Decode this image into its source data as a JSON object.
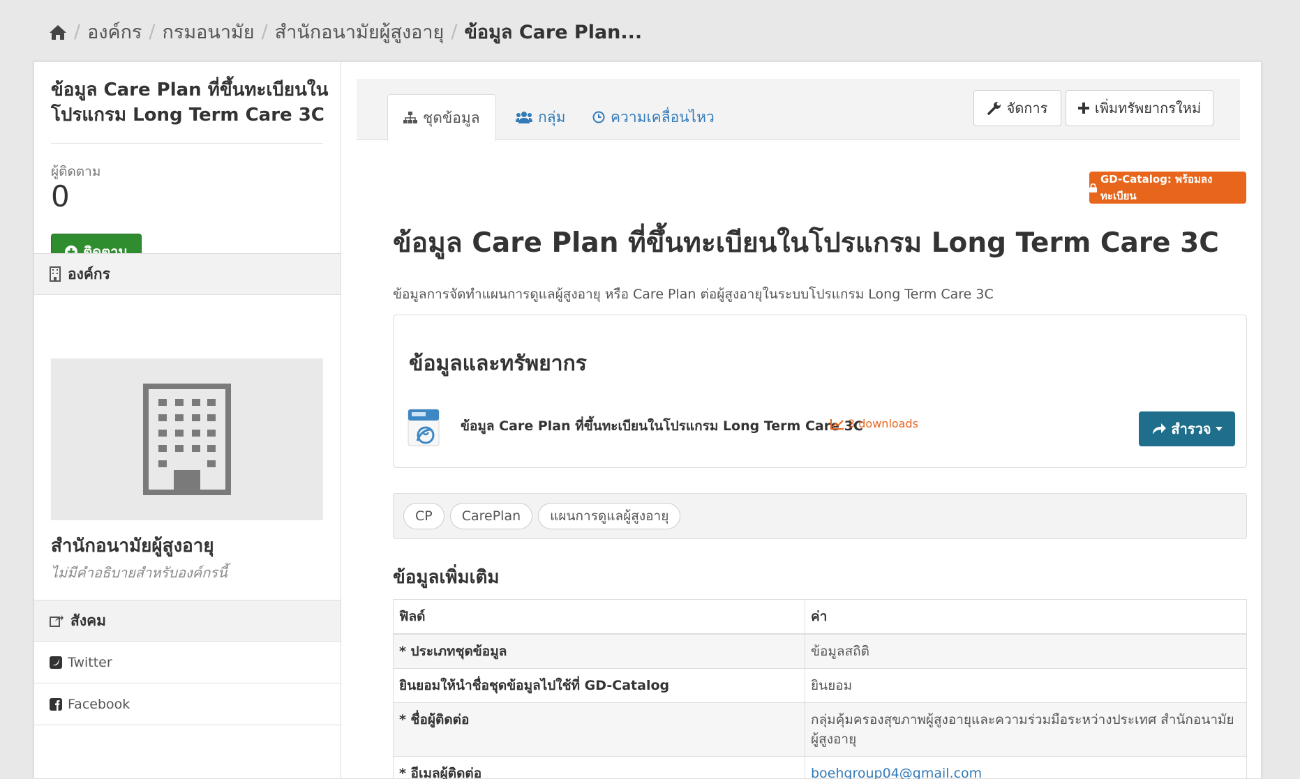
{
  "breadcrumb": {
    "home_icon": "home-icon",
    "items": [
      "องค์กร",
      "กรมอนามัย",
      "สำนักอนามัยผู้สูงอายุ",
      "ข้อมูล Care Plan..."
    ]
  },
  "sidebar": {
    "title": "ข้อมูล Care Plan ที่ขึ้นทะเบียนใน โปรแกรม Long Term Care 3C",
    "followers_label": "ผู้ติดตาม",
    "followers_count": "0",
    "follow_button": "ติดตาม",
    "org_heading": "องค์กร",
    "org_name": "สำนักอนามัยผู้สูงอายุ",
    "org_description": "ไม่มีคำอธิบายสำหรับองค์กรนี้",
    "social_heading": "สังคม",
    "social": [
      "Twitter",
      "Facebook"
    ]
  },
  "tabs": [
    {
      "label": "ชุดข้อมูล",
      "icon": "sitemap-icon",
      "active": true
    },
    {
      "label": "กลุ่ม",
      "icon": "users-icon",
      "active": false
    },
    {
      "label": "ความเคลื่อนไหว",
      "icon": "clock-icon",
      "active": false
    }
  ],
  "toolbar": {
    "manage": "จัดการ",
    "add_resource": "เพิ่มทรัพยากรใหม่"
  },
  "badge": "GD-Catalog: พร้อมลงทะเบียน",
  "dataset": {
    "title": "ข้อมูล Care Plan ที่ขึ้นทะเบียนในโปรแกรม Long Term Care 3C",
    "description": "ข้อมูลการจัดทำแผนการดูแลผู้สูงอายุ หรือ Care Plan ต่อผู้สูงอายุในระบบโปรแกรม Long Term Care 3C"
  },
  "resources": {
    "heading": "ข้อมูลและทรัพยากร",
    "items": [
      {
        "format": "HTML",
        "name": "ข้อมูล Care Plan ที่ขึ้นทะเบียนในโปรแกรม Long Term Care 3C",
        "downloads": "3 downloads",
        "explore": "สำรวจ"
      }
    ]
  },
  "tags": [
    "CP",
    "CarePlan",
    "แผนการดูแลผู้สูงอายุ"
  ],
  "additional": {
    "heading": "ข้อมูลเพิ่มเติม",
    "columns": [
      "ฟิลด์",
      "ค่า"
    ],
    "rows": [
      {
        "field": "* ประเภทชุดข้อมูล",
        "value": "ข้อมูลสถิติ"
      },
      {
        "field": "ยินยอมให้นำชื่อชุดข้อมูลไปใช้ที่ GD-Catalog",
        "value": "ยินยอม"
      },
      {
        "field": "* ชื่อผู้ติดต่อ",
        "value": "กลุ่มคุ้มครองสุขภาพผู้สูงอายุและความร่วมมือระหว่างประเทศ สำนักอนามัยผู้สูงอายุ"
      },
      {
        "field": "* อีเมลผู้ติดต่อ",
        "value": "boehgroup04@gmail.com"
      }
    ]
  },
  "colors": {
    "follow_green": "#2f8c2f",
    "badge_orange": "#e8661c",
    "explore_blue": "#1f6e8c",
    "link_blue": "#337ab7"
  }
}
